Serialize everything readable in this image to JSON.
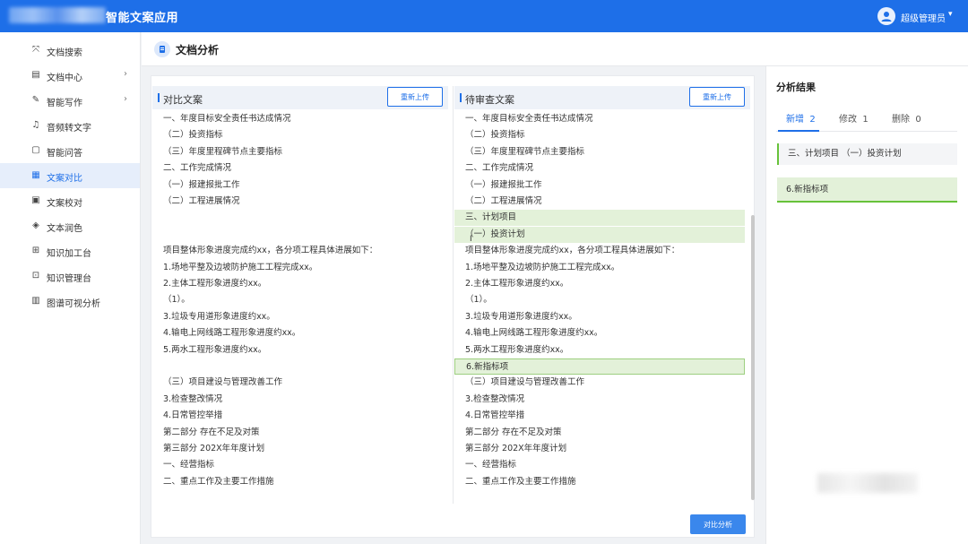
{
  "app": {
    "title": "智能文案应用"
  },
  "user": {
    "name": "超级管理员",
    "caret": "▾"
  },
  "sidebar": {
    "items": [
      {
        "label": "文档搜索",
        "icon": "⤧"
      },
      {
        "label": "文档中心",
        "icon": "▤",
        "arrow": "›"
      },
      {
        "label": "智能写作",
        "icon": "✎",
        "arrow": "›"
      },
      {
        "label": "音频转文字",
        "icon": "♫"
      },
      {
        "label": "智能问答",
        "icon": "▢"
      },
      {
        "label": "文案对比",
        "icon": "▦"
      },
      {
        "label": "文案校对",
        "icon": "▣"
      },
      {
        "label": "文本润色",
        "icon": "◈"
      },
      {
        "label": "知识加工台",
        "icon": "⊞"
      },
      {
        "label": "知识管理台",
        "icon": "⊡"
      },
      {
        "label": "图谱可视分析",
        "icon": "▥"
      }
    ],
    "active_index": 5
  },
  "page": {
    "title": "文档分析"
  },
  "left_panel": {
    "title": "对比文案",
    "reupload": "重新上传",
    "lines": [
      "一、年度目标安全责任书达成情况",
      "（二）投资指标",
      "（三）年度里程碑节点主要指标",
      "二、工作完成情况",
      "（一）报建报批工作",
      "（二）工程进展情况",
      "",
      "",
      "项目整体形象进度完成约xx，各分项工程具体进展如下：",
      "1.场地平整及边坡防护施工工程完成xx。",
      "2.主体工程形象进度约xx。",
      "（1）。",
      "3.垃圾专用道形象进度约xx。",
      "4.输电上网线路工程形象进度约xx。",
      "5.两水工程形象进度约xx。",
      "",
      "（三）项目建设与管理改善工作",
      "3.检查整改情况",
      "4.日常管控举措",
      "第二部分 存在不足及对策",
      "第三部分 202X年年度计划",
      "一、经营指标",
      "二、重点工作及主要工作措施"
    ]
  },
  "right_panel": {
    "title": "待审查文案",
    "reupload": "重新上传",
    "lines": [
      "一、年度目标安全责任书达成情况",
      "（二）投资指标",
      "（三）年度里程碑节点主要指标",
      "二、工作完成情况",
      "（一）报建报批工作",
      "（二）工程进展情况",
      "三、计划项目",
      "（一）投资计划",
      "项目整体形象进度完成约xx，各分项工程具体进展如下：",
      "1.场地平整及边坡防护施工工程完成xx。",
      "2.主体工程形象进度约xx。",
      "（1）。",
      "3.垃圾专用道形象进度约xx。",
      "4.输电上网线路工程形象进度约xx。",
      "5.两水工程形象进度约xx。",
      "6.新指标项",
      "（三）项目建设与管理改善工作",
      "3.检查整改情况",
      "4.日常管控举措",
      "第二部分 存在不足及对策",
      "第三部分 202X年年度计划",
      "一、经营指标",
      "二、重点工作及主要工作措施"
    ],
    "highlight_lines": [
      6,
      7
    ],
    "boxed_lines": [
      15
    ]
  },
  "analyze_button": "对比分析",
  "result": {
    "title": "分析结果",
    "tabs": [
      {
        "label": "新增",
        "count": "2"
      },
      {
        "label": "修改",
        "count": "1"
      },
      {
        "label": "删除",
        "count": "0"
      }
    ],
    "items": [
      "三、计划项目 （一）投资计划",
      "6.新指标项"
    ]
  },
  "colors": {
    "primary": "#1e6fe8",
    "added_bg": "#e3f1d9",
    "added_border": "#67c23a"
  },
  "icons": {
    "avatar": "user-avatar-icon",
    "page": "document-icon"
  }
}
